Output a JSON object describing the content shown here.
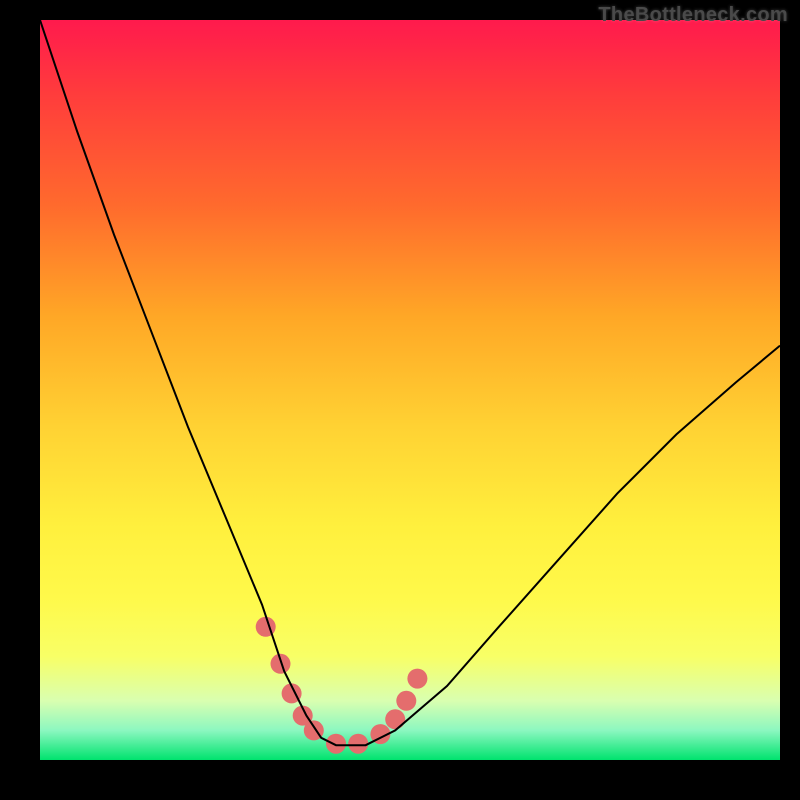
{
  "watermark": "TheBottleneck.com",
  "chart_data": {
    "type": "line",
    "title": "",
    "xlabel": "",
    "ylabel": "",
    "xlim": [
      0,
      100
    ],
    "ylim": [
      0,
      100
    ],
    "background_gradient": {
      "top": "#ff1a4d",
      "mid": "#ffd233",
      "bottom": "#00e36e"
    },
    "series": [
      {
        "name": "bottleneck-curve",
        "x": [
          0,
          5,
          10,
          15,
          20,
          25,
          30,
          33,
          36,
          38,
          40,
          44,
          48,
          55,
          62,
          70,
          78,
          86,
          94,
          100
        ],
        "y": [
          100,
          85,
          71,
          58,
          45,
          33,
          21,
          12,
          6,
          3,
          2,
          2,
          4,
          10,
          18,
          27,
          36,
          44,
          51,
          56
        ],
        "stroke": "#000000",
        "stroke_width": 2
      }
    ],
    "markers": [
      {
        "name": "salmon-dots",
        "x": [
          30.5,
          32.5,
          34,
          35.5,
          37,
          40,
          43,
          46,
          48,
          49.5,
          51
        ],
        "y": [
          18,
          13,
          9,
          6,
          4,
          2.2,
          2.2,
          3.5,
          5.5,
          8,
          11
        ],
        "color": "#e46d6d",
        "radius": 10
      }
    ]
  }
}
